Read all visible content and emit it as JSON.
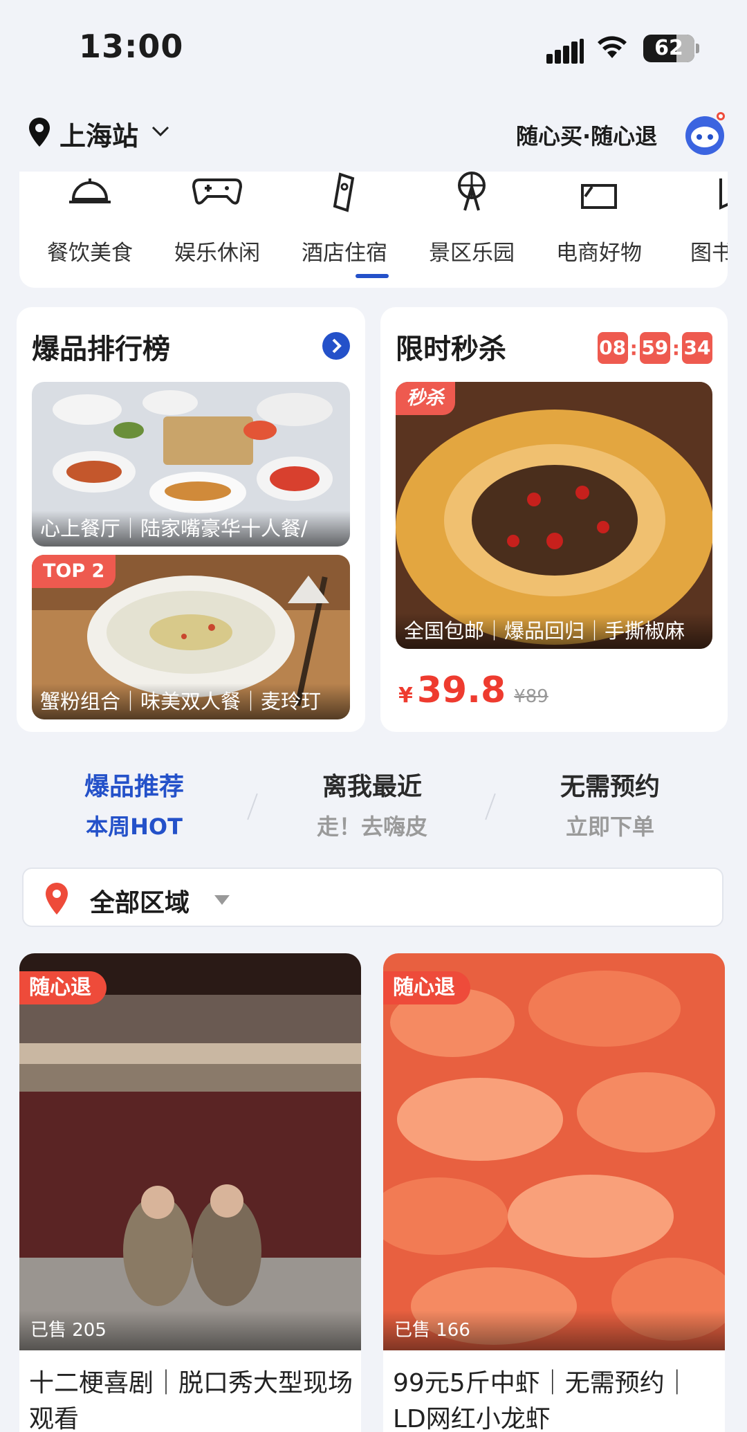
{
  "status_bar": {
    "time": "13:00",
    "battery": "62"
  },
  "header": {
    "city": "上海站",
    "slogan": "随心买·随心退"
  },
  "categories": [
    {
      "label": "餐饮美食",
      "icon": "dining-bell-icon"
    },
    {
      "label": "娱乐休闲",
      "icon": "gamepad-icon"
    },
    {
      "label": "酒店住宿",
      "icon": "hotel-tag-icon"
    },
    {
      "label": "景区乐园",
      "icon": "ferris-wheel-icon"
    },
    {
      "label": "电商好物",
      "icon": "shopping-bag-icon"
    },
    {
      "label": "图书",
      "icon": "book-icon"
    }
  ],
  "ranking": {
    "title": "爆品排行榜",
    "items": [
      {
        "caption": "心上餐厅｜陆家嘴豪华十人餐/",
        "tag": ""
      },
      {
        "caption": "蟹粉组合｜味美双人餐｜麦玲玎",
        "tag": "TOP 2"
      }
    ]
  },
  "flash_sale": {
    "title": "限时秒杀",
    "timer": {
      "h": "08",
      "m": "59",
      "s": "34",
      "sep": ":"
    },
    "badge": "秒杀",
    "caption": "全国包邮｜爆品回归｜手撕椒麻",
    "price_symbol": "¥",
    "price": "39.8",
    "original_price": "¥89"
  },
  "tabs": [
    {
      "main": "爆品推荐",
      "sub": "本周HOT",
      "active": true
    },
    {
      "main": "离我最近",
      "sub": "走！去嗨皮",
      "active": false
    },
    {
      "main": "无需预约",
      "sub": "立即下单",
      "active": false
    }
  ],
  "region_filter": {
    "label": "全部区域"
  },
  "products": [
    {
      "tag": "随心退",
      "sold": "已售 205",
      "title": "十二梗喜剧｜脱口秀大型现场观看"
    },
    {
      "tag": "随心退",
      "sold": "已售 166",
      "title": "99元5斤中虾｜无需预约｜LD网红小龙虾"
    }
  ],
  "colors": {
    "accent": "#2451c9",
    "price": "#ee3b2f",
    "tag": "#ee4b3a"
  }
}
